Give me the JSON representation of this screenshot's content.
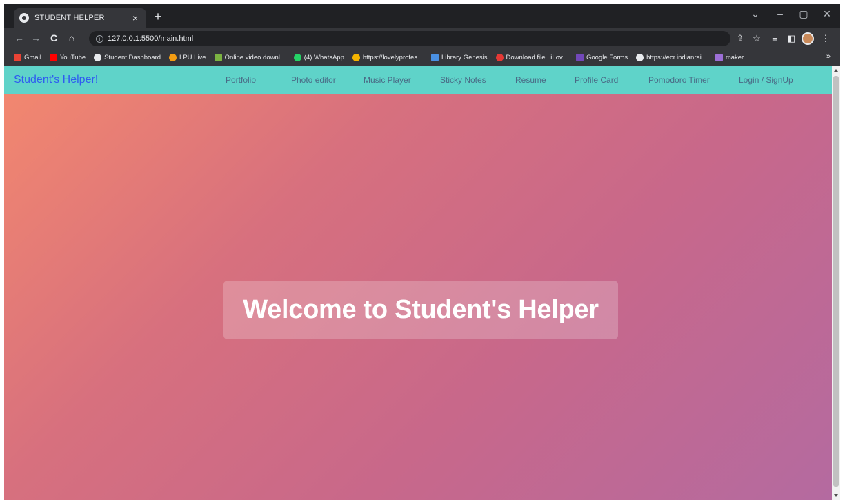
{
  "browser": {
    "tab": {
      "title": "STUDENT HELPER",
      "close_glyph": "×"
    },
    "new_tab_glyph": "+",
    "window_controls": {
      "menu": "⌄",
      "minimize": "–",
      "restore": "▢",
      "close": "✕"
    },
    "nav": {
      "back": "←",
      "forward": "→",
      "reload": "C",
      "home": "⌂"
    },
    "url": "127.0.0.1:5500/main.html",
    "info_glyph": "i",
    "toolbar_icons": {
      "share": "⇪",
      "bookmark_star": "☆",
      "reading_list": "≡",
      "side_panel": "◧",
      "menu": "⋮"
    },
    "bookmarks": [
      {
        "label": "Gmail",
        "color": "#ea4335"
      },
      {
        "label": "YouTube",
        "color": "#ff0000"
      },
      {
        "label": "Student Dashboard",
        "color": "#e8eaed"
      },
      {
        "label": "LPU Live",
        "color": "#f39c12"
      },
      {
        "label": "Online video downl...",
        "color": "#7cb342"
      },
      {
        "label": "(4) WhatsApp",
        "color": "#25d366"
      },
      {
        "label": "https://lovelyprofes...",
        "color": "#f4b400"
      },
      {
        "label": "Library Genesis",
        "color": "#4a90e2"
      },
      {
        "label": "Download file | iLov...",
        "color": "#e53935"
      },
      {
        "label": "Google Forms",
        "color": "#7248b9"
      },
      {
        "label": "https://ecr.indianrai...",
        "color": "#e8eaed"
      },
      {
        "label": "maker",
        "color": "#9c6fd6"
      }
    ],
    "bookmarks_more": "»"
  },
  "page": {
    "brand": "Student's Helper!",
    "nav_links": [
      "Portfolio",
      "Photo editor",
      "Music Player",
      "Sticky Notes",
      "Resume",
      "Profile Card",
      "Pomodoro Timer",
      "Login / SignUp"
    ],
    "hero_title": "Welcome to Student's Helper"
  },
  "colors": {
    "navbar": "#5fd3c9",
    "brand": "#2f5cf0",
    "nav_link": "#4a6b86",
    "gradient_start": "#f2876f",
    "gradient_end": "#b46aa0"
  }
}
